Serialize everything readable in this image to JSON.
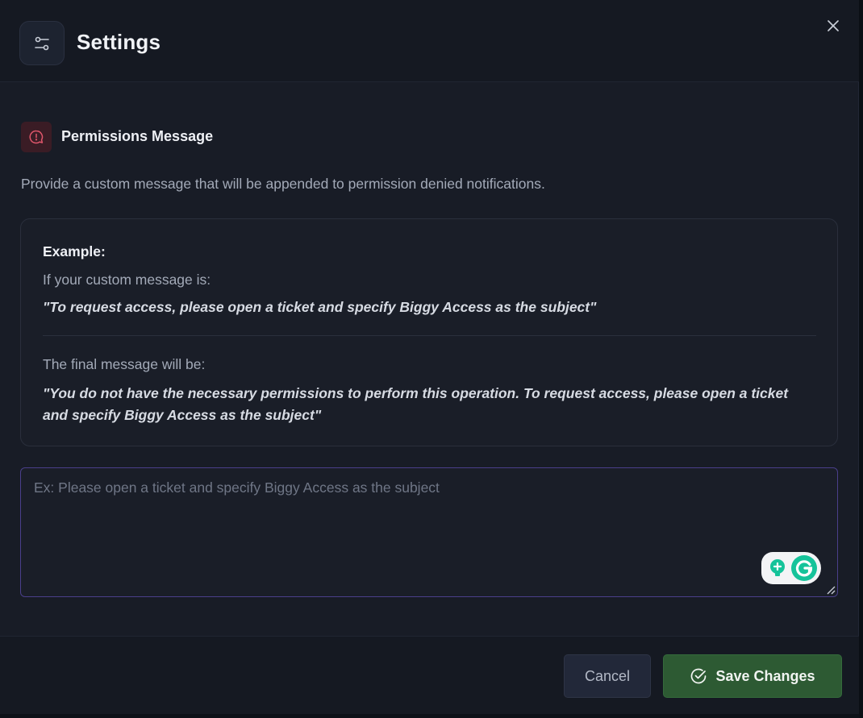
{
  "header": {
    "title": "Settings"
  },
  "section": {
    "title": "Permissions Message",
    "description": "Provide a custom message that will be appended to permission denied notifications."
  },
  "example": {
    "label": "Example:",
    "custom_intro": "If your custom message is:",
    "custom_quote": "\"To request access, please open a ticket and specify Biggy Access as the subject\"",
    "final_intro": "The final message will be:",
    "final_quote": "\"You do not have the necessary permissions to perform this operation. To request access, please open a ticket and specify Biggy Access as the subject\""
  },
  "input": {
    "value": "",
    "placeholder": "Ex: Please open a ticket and specify Biggy Access as the subject"
  },
  "footer": {
    "cancel_label": "Cancel",
    "save_label": "Save Changes"
  },
  "icons": {
    "header": "sliders-icon",
    "close": "close-icon",
    "section": "alert-message-icon",
    "save": "check-circle-icon",
    "grammarly_suggestion": "lightbulb-icon",
    "grammarly_logo": "grammarly-icon"
  },
  "colors": {
    "accent_focus": "#4a3f8a",
    "save_button": "#2d5a33",
    "alert_icon": "#e0566b",
    "grammarly_green": "#15c39a"
  }
}
